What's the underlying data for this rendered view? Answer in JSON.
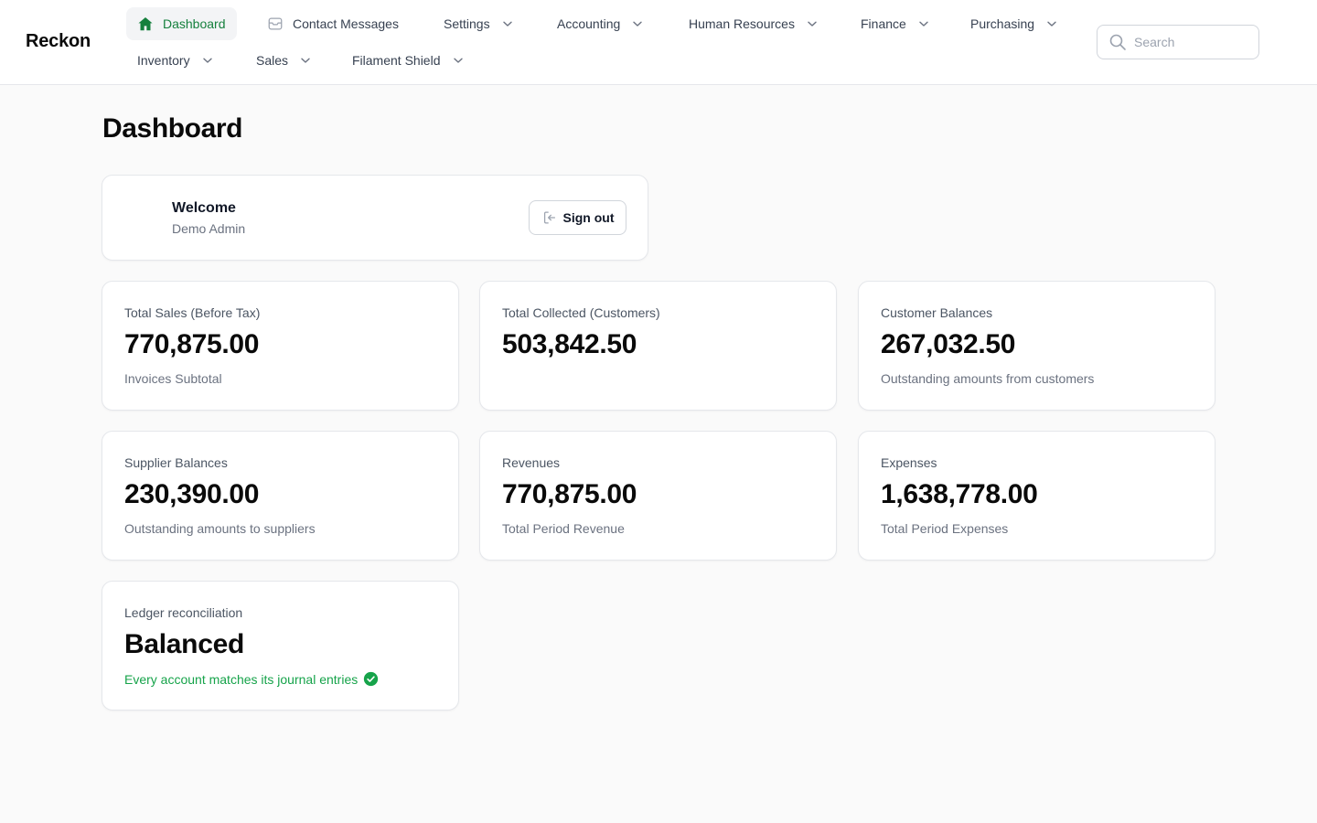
{
  "brand": "Reckon",
  "nav": {
    "dashboard": "Dashboard",
    "contact_messages": "Contact Messages",
    "settings": "Settings",
    "accounting": "Accounting",
    "human_resources": "Human Resources",
    "finance": "Finance",
    "purchasing": "Purchasing",
    "inventory": "Inventory",
    "sales": "Sales",
    "filament_shield": "Filament Shield"
  },
  "search": {
    "placeholder": "Search"
  },
  "page": {
    "title": "Dashboard"
  },
  "welcome": {
    "title": "Welcome",
    "user": "Demo Admin",
    "sign_out_label": "Sign out"
  },
  "stats": [
    {
      "label": "Total Sales (Before Tax)",
      "value": "770,875.00",
      "description": "Invoices Subtotal"
    },
    {
      "label": "Total Collected (Customers)",
      "value": "503,842.50",
      "description": ""
    },
    {
      "label": "Customer Balances",
      "value": "267,032.50",
      "description": "Outstanding amounts from customers"
    },
    {
      "label": "Supplier Balances",
      "value": "230,390.00",
      "description": "Outstanding amounts to suppliers"
    },
    {
      "label": "Revenues",
      "value": "770,875.00",
      "description": "Total Period Revenue"
    },
    {
      "label": "Expenses",
      "value": "1,638,778.00",
      "description": "Total Period Expenses"
    },
    {
      "label": "Ledger reconciliation",
      "value": "Balanced",
      "description": "Every account matches its journal entries",
      "status": "success"
    }
  ],
  "colors": {
    "accent": "#15803d",
    "success": "#16a34a",
    "background": "#fafafa",
    "card_border": "#e5e7eb"
  },
  "icons": {
    "dashboard": "home-icon",
    "contact_messages": "inbox-icon",
    "dropdown": "chevron-down-icon",
    "search": "search-icon",
    "sign_out": "sign-out-icon",
    "success": "check-circle-icon"
  }
}
